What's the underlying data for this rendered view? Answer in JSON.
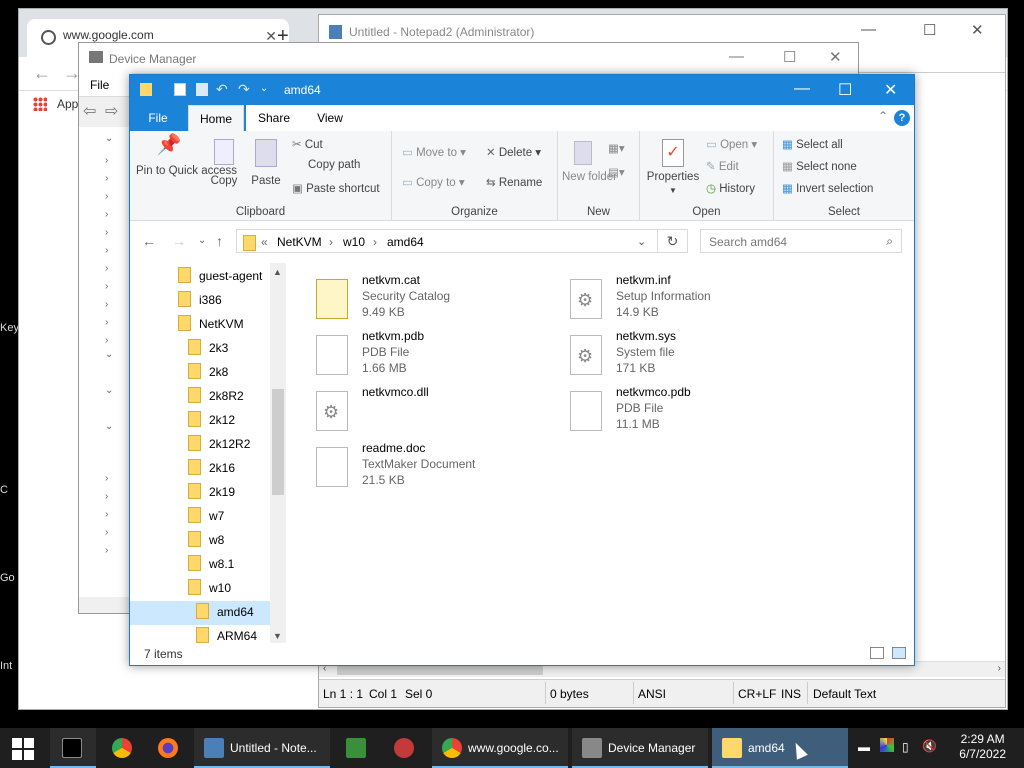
{
  "desktop": {
    "labels": [
      "Key",
      "C",
      "Go",
      "Int"
    ]
  },
  "chrome": {
    "tab_title": "www.google.com",
    "bookmark": "App",
    "menu_file": "File"
  },
  "notepad": {
    "title": "Untitled - Notepad2 (Administrator)",
    "status": {
      "pos": "Ln 1 : 1",
      "col": "Col 1",
      "sel": "Sel 0",
      "size": "0 bytes",
      "enc": "ANSI",
      "eol": "CR+LF",
      "ins": "INS",
      "scheme": "Default Text"
    }
  },
  "devmgr": {
    "title": "Device Manager"
  },
  "explorer": {
    "title": "amd64",
    "tabs": {
      "file": "File",
      "home": "Home",
      "share": "Share",
      "view": "View"
    },
    "ribbon": {
      "clipboard": {
        "label": "Clipboard",
        "pin": "Pin to Quick access",
        "copy": "Copy",
        "paste": "Paste",
        "cut": "Cut",
        "copy_path": "Copy path",
        "paste_shortcut": "Paste shortcut"
      },
      "organize": {
        "label": "Organize",
        "move_to": "Move to",
        "copy_to": "Copy to",
        "delete": "Delete",
        "rename": "Rename"
      },
      "new": {
        "label": "New",
        "new_folder": "New folder"
      },
      "open": {
        "label": "Open",
        "properties": "Properties",
        "open": "Open",
        "edit": "Edit",
        "history": "History"
      },
      "select": {
        "label": "Select",
        "select_all": "Select all",
        "select_none": "Select none",
        "invert": "Invert selection"
      }
    },
    "address": {
      "prefix": "«",
      "path": [
        "NetKVM",
        "w10",
        "amd64"
      ]
    },
    "search_placeholder": "Search amd64",
    "nav": [
      {
        "label": "guest-agent",
        "indent": 0
      },
      {
        "label": "i386",
        "indent": 0
      },
      {
        "label": "NetKVM",
        "indent": 0
      },
      {
        "label": "2k3",
        "indent": 1
      },
      {
        "label": "2k8",
        "indent": 1
      },
      {
        "label": "2k8R2",
        "indent": 1
      },
      {
        "label": "2k12",
        "indent": 1
      },
      {
        "label": "2k12R2",
        "indent": 1
      },
      {
        "label": "2k16",
        "indent": 1
      },
      {
        "label": "2k19",
        "indent": 1
      },
      {
        "label": "w7",
        "indent": 1
      },
      {
        "label": "w8",
        "indent": 1
      },
      {
        "label": "w8.1",
        "indent": 1
      },
      {
        "label": "w10",
        "indent": 1
      },
      {
        "label": "amd64",
        "indent": 2
      },
      {
        "label": "ARM64",
        "indent": 2
      }
    ],
    "files": [
      {
        "name": "netkvm.cat",
        "type": "Security Catalog",
        "size": "9.49 KB",
        "icon": "catalog-icon"
      },
      {
        "name": "netkvm.inf",
        "type": "Setup Information",
        "size": "14.9 KB",
        "icon": "setup-info-icon"
      },
      {
        "name": "netkvm.pdb",
        "type": "PDB File",
        "size": "1.66 MB",
        "icon": "file-icon"
      },
      {
        "name": "netkvm.sys",
        "type": "System file",
        "size": "171 KB",
        "icon": "system-file-icon"
      },
      {
        "name": "netkvmco.dll",
        "type": "",
        "size": "",
        "icon": "dll-icon"
      },
      {
        "name": "netkvmco.pdb",
        "type": "PDB File",
        "size": "11.1 MB",
        "icon": "file-icon"
      },
      {
        "name": "readme.doc",
        "type": "TextMaker Document",
        "size": "21.5 KB",
        "icon": "document-icon"
      }
    ],
    "status": "7 items"
  },
  "taskbar": {
    "items": [
      {
        "label": "",
        "icon": "terminal-icon"
      },
      {
        "label": "",
        "icon": "chrome-icon"
      },
      {
        "label": "",
        "icon": "firefox-icon"
      },
      {
        "label": "Untitled - Note...",
        "icon": "notepad-icon"
      },
      {
        "label": "",
        "icon": "spreadsheet-icon"
      },
      {
        "label": "",
        "icon": "app-icon"
      },
      {
        "label": "www.google.co...",
        "icon": "chrome-icon"
      },
      {
        "label": "Device Manager",
        "icon": "device-manager-icon"
      },
      {
        "label": "amd64",
        "icon": "folder-icon"
      }
    ],
    "time": "2:29 AM",
    "date": "6/7/2022"
  }
}
